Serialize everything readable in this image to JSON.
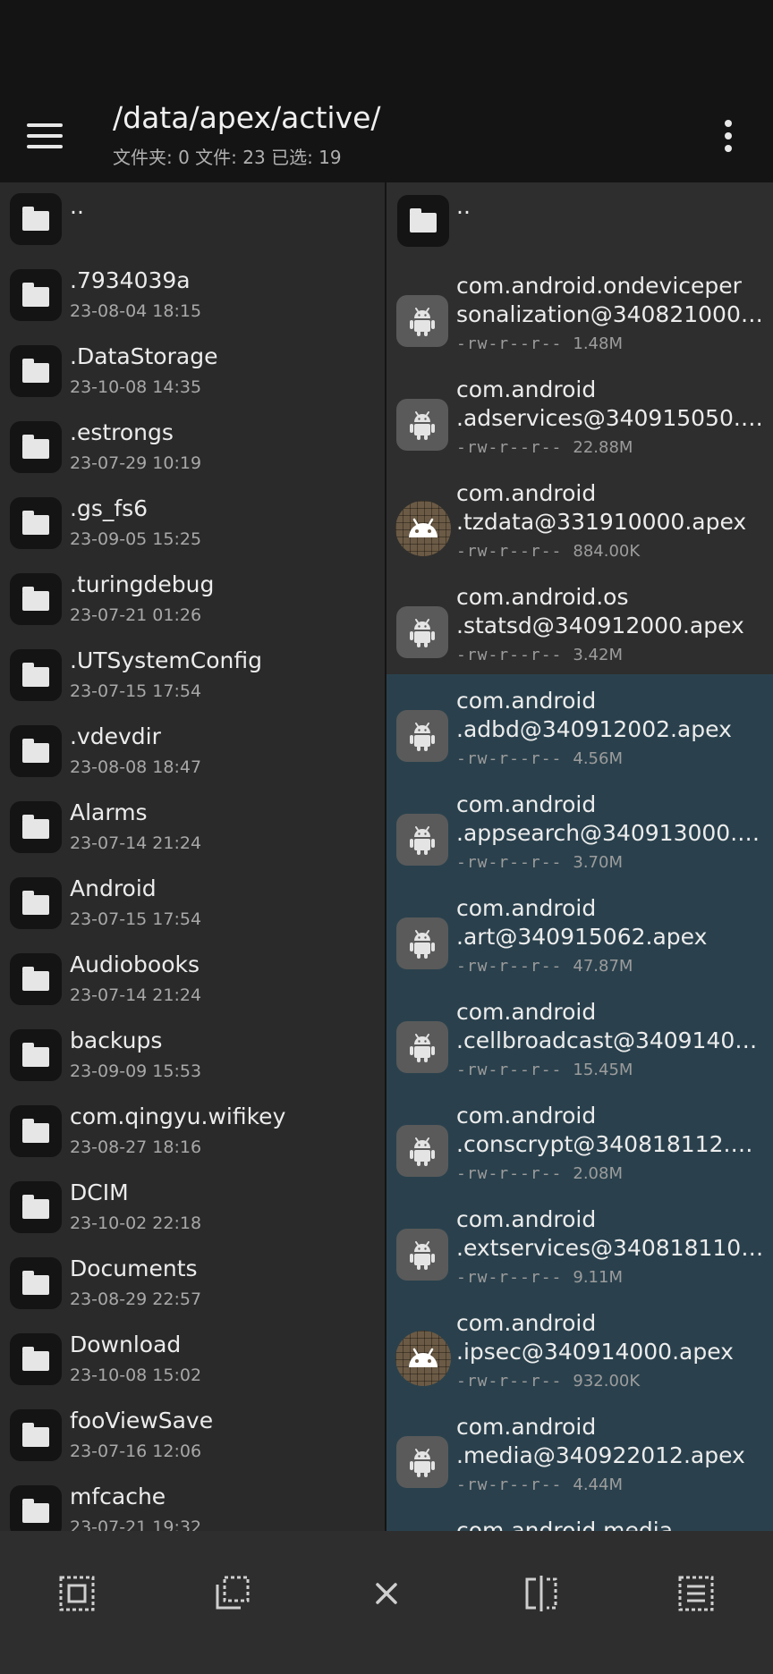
{
  "app_bar": {
    "title": "/data/apex/active/",
    "subtitle": "文件夹: 0  文件: 23  已选: 19"
  },
  "left_pane": {
    "parent_label": "..",
    "items": [
      {
        "name": ".7934039a",
        "date": "23-08-04 18:15"
      },
      {
        "name": ".DataStorage",
        "date": "23-10-08 14:35"
      },
      {
        "name": ".estrongs",
        "date": "23-07-29 10:19"
      },
      {
        "name": ".gs_fs6",
        "date": "23-09-05 15:25"
      },
      {
        "name": ".turingdebug",
        "date": "23-07-21 01:26"
      },
      {
        "name": ".UTSystemConfig",
        "date": "23-07-15 17:54"
      },
      {
        "name": ".vdevdir",
        "date": "23-08-08 18:47"
      },
      {
        "name": "Alarms",
        "date": "23-07-14 21:24"
      },
      {
        "name": "Android",
        "date": "23-07-15 17:54"
      },
      {
        "name": "Audiobooks",
        "date": "23-07-14 21:24"
      },
      {
        "name": "backups",
        "date": "23-09-09 15:53"
      },
      {
        "name": "com.qingyu.wifikey",
        "date": "23-08-27 18:16"
      },
      {
        "name": "DCIM",
        "date": "23-10-02 22:18"
      },
      {
        "name": "Documents",
        "date": "23-08-29 22:57"
      },
      {
        "name": "Download",
        "date": "23-10-08 15:02"
      },
      {
        "name": "fooViewSave",
        "date": "23-07-16 12:06"
      },
      {
        "name": "mfcache",
        "date": "23-07-21 19:32"
      }
    ]
  },
  "right_pane": {
    "parent_label": "..",
    "items": [
      {
        "line1": "com.android.ondeviceper",
        "line2": "sonalization@340821000.…",
        "perm": "-rw-r--r--",
        "size": "1.48M",
        "icon": "android-apk-icon",
        "selected": false
      },
      {
        "line1": "com.android",
        "line2": ".adservices@340915050.a…",
        "perm": "-rw-r--r--",
        "size": "22.88M",
        "icon": "android-apk-icon",
        "selected": false
      },
      {
        "line1": "com.android",
        "line2": ".tzdata@331910000.apex",
        "perm": "-rw-r--r--",
        "size": "884.00K",
        "icon": "android-round-icon",
        "selected": false
      },
      {
        "line1": "com.android.os",
        "line2": ".statsd@340912000.apex",
        "perm": "-rw-r--r--",
        "size": "3.42M",
        "icon": "android-apk-icon",
        "selected": false
      },
      {
        "line1": "com.android",
        "line2": ".adbd@340912002.apex",
        "perm": "-rw-r--r--",
        "size": "4.56M",
        "icon": "android-apk-icon",
        "selected": true
      },
      {
        "line1": "com.android",
        "line2": ".appsearch@340913000.a…",
        "perm": "-rw-r--r--",
        "size": "3.70M",
        "icon": "android-apk-icon",
        "selected": true
      },
      {
        "line1": "com.android",
        "line2": ".art@340915062.apex",
        "perm": "-rw-r--r--",
        "size": "47.87M",
        "icon": "android-apk-icon",
        "selected": true
      },
      {
        "line1": "com.android",
        "line2": ".cellbroadcast@34091400…",
        "perm": "-rw-r--r--",
        "size": "15.45M",
        "icon": "android-apk-icon",
        "selected": true
      },
      {
        "line1": "com.android",
        "line2": ".conscrypt@340818112.a…",
        "perm": "-rw-r--r--",
        "size": "2.08M",
        "icon": "android-apk-icon",
        "selected": true
      },
      {
        "line1": "com.android",
        "line2": ".extservices@340818110.…",
        "perm": "-rw-r--r--",
        "size": "9.11M",
        "icon": "android-apk-icon",
        "selected": true
      },
      {
        "line1": "com.android",
        "line2": ".ipsec@340914000.apex",
        "perm": "-rw-r--r--",
        "size": "932.00K",
        "icon": "android-round-icon",
        "selected": true
      },
      {
        "line1": "com.android",
        "line2": ".media@340922012.apex",
        "perm": "-rw-r--r--",
        "size": "4.44M",
        "icon": "android-apk-icon",
        "selected": true
      },
      {
        "line1": "com.android.media",
        "line2": "",
        "perm": "",
        "size": "",
        "icon": "android-apk-icon",
        "selected": true
      }
    ]
  },
  "bottom_bar": {
    "buttons": [
      "select-all-icon",
      "select-invert-icon",
      "close-icon",
      "split-view-icon",
      "list-menu-icon"
    ]
  },
  "colors": {
    "background": "#2a2a2a",
    "app_bar": "#141414",
    "selected_row": "#2a414d",
    "bottom_bar": "#2e2e2e"
  }
}
